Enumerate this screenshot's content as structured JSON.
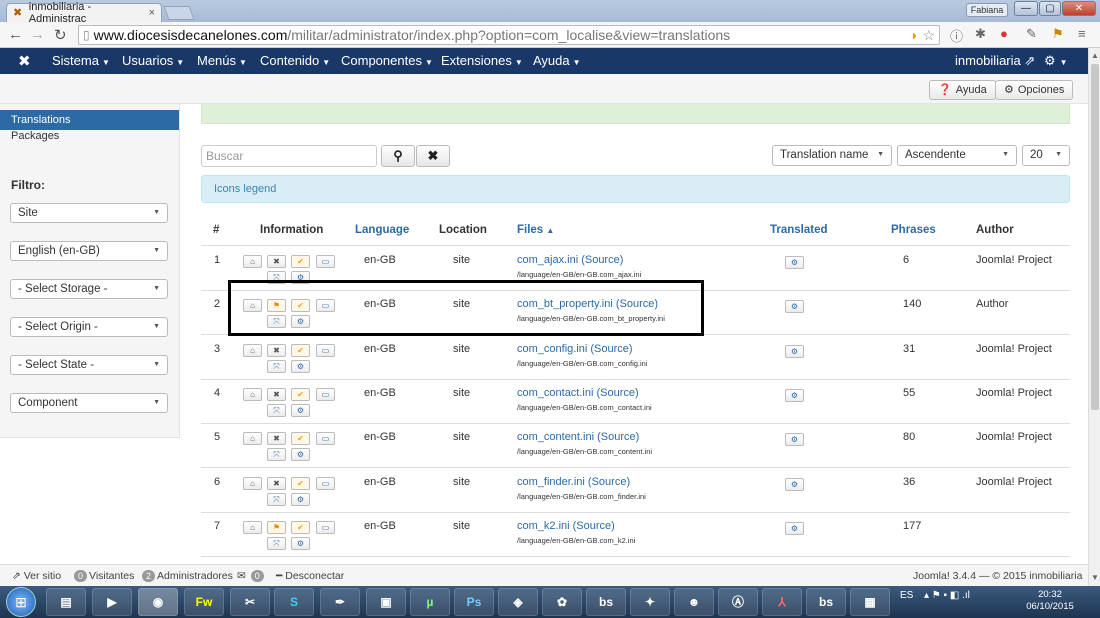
{
  "browser": {
    "tab_title": "inmobiliaria - Administrac",
    "tab_close": "×",
    "profile_name": "Fabiana",
    "url_host": "www.diocesisdecanelones.com",
    "url_path": "/militar/administrator/index.php?option=com_localise&view=translations",
    "window_buttons": [
      "—",
      "▢",
      "✕"
    ]
  },
  "navbar": {
    "logo": "✖",
    "menus": [
      "Sistema",
      "Usuarios",
      "Menús",
      "Contenido",
      "Componentes",
      "Extensiones",
      "Ayuda"
    ],
    "site_name": "inmobiliaria",
    "site_link_icon": "⇗",
    "settings_icon": "⚙"
  },
  "toolbar": {
    "help_label": "Ayuda",
    "options_label": "Opciones"
  },
  "sidebar": {
    "active_item": "Translations",
    "items": [
      "Packages"
    ],
    "filter_title": "Filtro:",
    "filters": [
      "Site",
      "English (en-GB)",
      "- Select Storage -",
      "- Select Origin -",
      "- Select State -",
      "Component"
    ]
  },
  "search": {
    "placeholder": "Buscar",
    "search_icon": "🔍",
    "clear_icon": "✖"
  },
  "sort": {
    "field": "Translation name",
    "direction": "Ascendente",
    "limit": "20"
  },
  "legend": {
    "label": "Icons legend"
  },
  "table": {
    "headers": [
      "#",
      "Information",
      "Language",
      "Location",
      "Files",
      "Translated",
      "Phrases",
      "Author"
    ],
    "files_sort_indicator": "▲",
    "rows": [
      {
        "num": "1",
        "language": "en-GB",
        "location": "site",
        "file": "com_ajax.ini (Source)",
        "path": "/language/en-GB/en-GB.com_ajax.ini",
        "phrases": "6",
        "author": "Joomla! Project",
        "origin": "core"
      },
      {
        "num": "2",
        "language": "en-GB",
        "location": "site",
        "file": "com_bt_property.ini (Source)",
        "path": "/language/en-GB/en-GB.com_bt_property.ini",
        "phrases": "140",
        "author": "Author",
        "origin": "third"
      },
      {
        "num": "3",
        "language": "en-GB",
        "location": "site",
        "file": "com_config.ini (Source)",
        "path": "/language/en-GB/en-GB.com_config.ini",
        "phrases": "31",
        "author": "Joomla! Project",
        "origin": "core"
      },
      {
        "num": "4",
        "language": "en-GB",
        "location": "site",
        "file": "com_contact.ini (Source)",
        "path": "/language/en-GB/en-GB.com_contact.ini",
        "phrases": "55",
        "author": "Joomla! Project",
        "origin": "core"
      },
      {
        "num": "5",
        "language": "en-GB",
        "location": "site",
        "file": "com_content.ini (Source)",
        "path": "/language/en-GB/en-GB.com_content.ini",
        "phrases": "80",
        "author": "Joomla! Project",
        "origin": "core"
      },
      {
        "num": "6",
        "language": "en-GB",
        "location": "site",
        "file": "com_finder.ini (Source)",
        "path": "/language/en-GB/en-GB.com_finder.ini",
        "phrases": "36",
        "author": "Joomla! Project",
        "origin": "core"
      },
      {
        "num": "7",
        "language": "en-GB",
        "location": "site",
        "file": "com_k2.ini (Source)",
        "path": "/language/en-GB/en-GB.com_k2.ini",
        "phrases": "177",
        "author": "",
        "origin": "third"
      }
    ]
  },
  "statusbar": {
    "view_site": "Ver sitio",
    "visitors_count": "0",
    "visitors_label": "Visitantes",
    "admins_count": "2",
    "admins_label": "Administradores",
    "messages_count": "0",
    "logout": "Desconectar",
    "version": "Joomla! 3.4.4 — © 2015 inmobiliaria"
  },
  "taskbar": {
    "language": "ES",
    "time": "20:32",
    "date": "06/10/2015"
  },
  "colors": {
    "navbar": "#1a3867",
    "link": "#2c6aa6",
    "sidebar_active": "#2c6aa6",
    "legend_bg": "#d9edf7"
  }
}
